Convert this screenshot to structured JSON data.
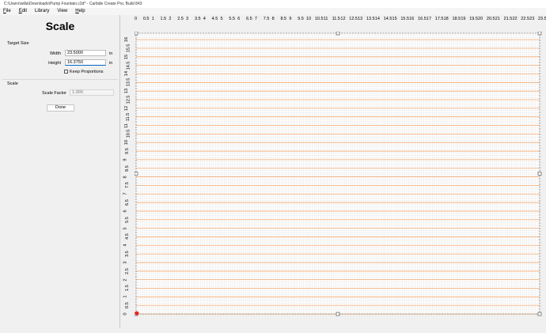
{
  "window": {
    "title": "C:\\Users\\willa\\Downloads\\Pump Fountain.c2d* - Carbide Create Pro, Build 843"
  },
  "menu": {
    "items": [
      {
        "mnemonic": "F",
        "rest": "ile"
      },
      {
        "mnemonic": "E",
        "rest": "dit"
      },
      {
        "mnemonic": "",
        "rest": "Library"
      },
      {
        "mnemonic": "",
        "rest": "View"
      },
      {
        "mnemonic": "H",
        "rest": "elp"
      }
    ]
  },
  "panel": {
    "title": "Scale",
    "target_size_label": "Target Size",
    "width_label": "Width",
    "width_value": "23.5000",
    "width_unit": "in",
    "height_label": "Height",
    "height_value": "16.3750",
    "height_unit": "in",
    "keep_proportions_label": "Keep Proportions",
    "keep_proportions_checked": false,
    "scale_label": "Scale",
    "scale_factor_label": "Scale Factor",
    "scale_factor_placeholder": "1.000",
    "done_label": "Done"
  },
  "canvas": {
    "ruler_x_labels": [
      "0",
      "0.5",
      "1",
      "1.5",
      "2",
      "2.5",
      "3",
      "3.5",
      "4",
      "4.5",
      "5",
      "5.5",
      "6",
      "6.5",
      "7",
      "7.5",
      "8",
      "8.5",
      "9",
      "9.5",
      "10",
      "10.5",
      "11",
      "11.5",
      "12",
      "12.5",
      "13",
      "13.5",
      "14",
      "14.5",
      "15",
      "15.5",
      "16",
      "16.5",
      "17",
      "17.5",
      "18",
      "18.5",
      "19",
      "19.5",
      "20",
      "20.5",
      "21",
      "21.5",
      "22",
      "22.5",
      "23",
      "23.5"
    ],
    "ruler_y_labels": [
      "0",
      "0.5",
      "1",
      "1.5",
      "2",
      "2.5",
      "3",
      "3.5",
      "4",
      "4.5",
      "5",
      "5.5",
      "6",
      "6.5",
      "7",
      "7.5",
      "8",
      "8.5",
      "9",
      "9.5",
      "10",
      "10.5",
      "11",
      "11.5",
      "12",
      "12.5",
      "13",
      "13.5",
      "14",
      "14.5",
      "15",
      "15.5",
      "16"
    ],
    "colors": {
      "background": "#ffffff",
      "minor_grid": "#e6e6e6",
      "orange_lines": "#f2a66b",
      "selection": "#555555",
      "origin_marker": "#e8231f"
    }
  }
}
